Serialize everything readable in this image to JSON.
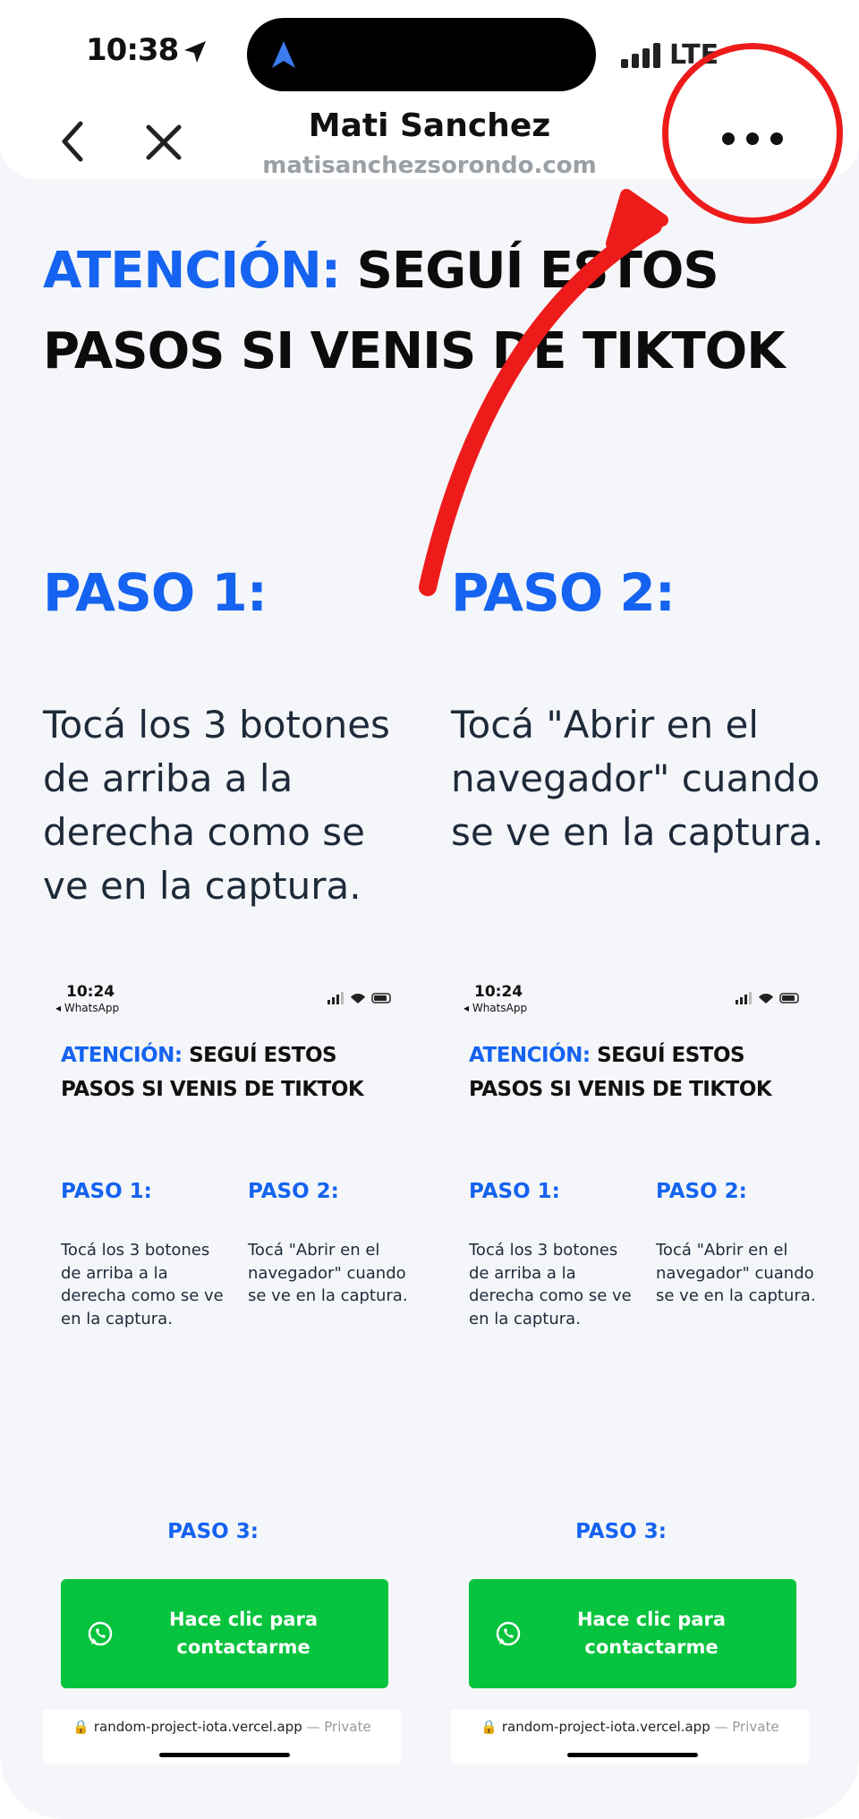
{
  "status_bar": {
    "time": "10:38",
    "carrier": "LTE"
  },
  "browser": {
    "site_title": "Mati Sanchez",
    "site_url": "matisanchezsorondo.com"
  },
  "headline": {
    "accent": "ATENCIÓN:",
    "rest": " SEGUÍ ESTOS PASOS SI VENIS DE TIKTOK"
  },
  "steps": [
    {
      "title": "PASO 1:",
      "text": "Tocá los 3 botones de arriba a la derecha como se ve en la captura."
    },
    {
      "title": "PASO 2:",
      "text": "Tocá \"Abrir en el navegador\" cuando se ve en la captura."
    }
  ],
  "mini_screenshot": {
    "time": "10:24",
    "back_label": "◂ WhatsApp",
    "headline_accent": "ATENCIÓN:",
    "headline_rest": " SEGUÍ ESTOS PASOS SI VENIS DE TIKTOK",
    "paso1": "PASO 1:",
    "paso1_text": "Tocá los 3 botones de arriba a la derecha como se ve en la captura.",
    "paso2": "PASO 2:",
    "paso2_text": "Tocá \"Abrir en el navegador\" cuando se ve en la captura.",
    "paso3": "PASO 3:",
    "button_label": "Hace clic para contactarme",
    "url": "random-project-iota.vercel.app",
    "url_suffix": " — Private"
  },
  "colors": {
    "accent_blue": "#1563f0",
    "whatsapp_green": "#07c33d",
    "annotation_red": "#ee1b1b"
  }
}
